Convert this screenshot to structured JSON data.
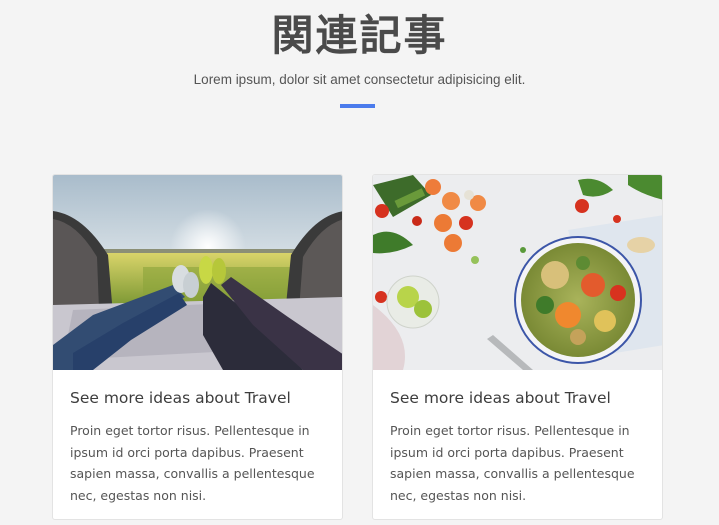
{
  "section": {
    "title": "関連記事",
    "subtitle": "Lorem ipsum, dolor sit amet consectetur adipisicing elit.",
    "accent_color": "#4b7bec"
  },
  "cards": [
    {
      "image_label": "travel-feet-car-trunk-photo",
      "title": "See more ideas about Travel",
      "text": "Proin eget tortor risus. Pellentesque in ipsum id orci porta dapibus. Praesent sapien massa, convallis a pellentesque nec, egestas non nisi."
    },
    {
      "image_label": "healthy-salad-bowl-photo",
      "title": "See more ideas about Travel",
      "text": "Proin eget tortor risus. Pellentesque in ipsum id orci porta dapibus. Praesent sapien massa, convallis a pellentesque nec, egestas non nisi."
    }
  ]
}
